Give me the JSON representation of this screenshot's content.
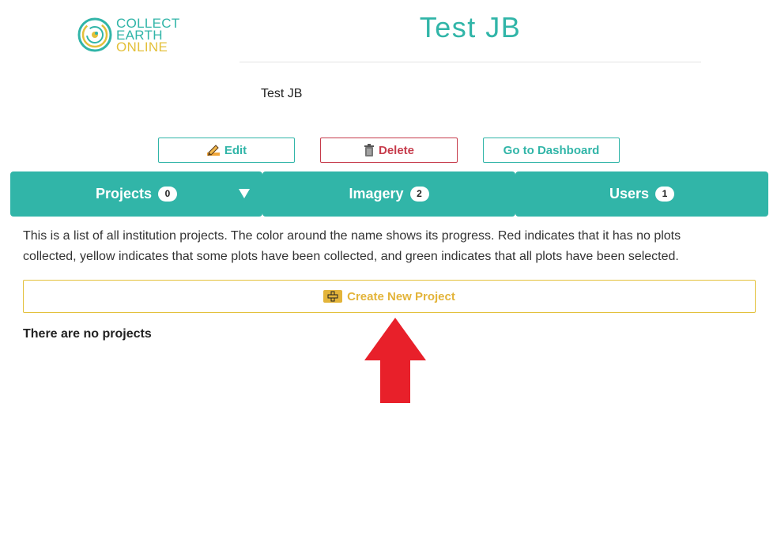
{
  "logo": {
    "line1": "COLLECT EARTH",
    "line2": "ONLINE",
    "icon": "collect-earth-logo-icon"
  },
  "institution": {
    "title": "Test JB",
    "description": "Test JB"
  },
  "actions": {
    "edit_label": "Edit",
    "edit_icon": "pencil-icon",
    "delete_label": "Delete",
    "delete_icon": "trash-icon",
    "dashboard_label": "Go to Dashboard"
  },
  "tabs": [
    {
      "label": "Projects",
      "count": "0"
    },
    {
      "label": "Imagery",
      "count": "2"
    },
    {
      "label": "Users",
      "count": "1"
    }
  ],
  "projects": {
    "info": "This is a list of all institution projects. The color around the name shows its progress. Red indicates that it has no plots collected, yellow indicates that some plots have been collected, and green indicates that all plots have been selected.",
    "create_label": "Create New Project",
    "create_icon": "plus-icon",
    "empty_message": "There are no projects"
  },
  "colors": {
    "accent": "#31b5a8",
    "danger": "#c63b4b",
    "warning": "#e3b43a",
    "annotation_arrow": "#e8202a"
  }
}
